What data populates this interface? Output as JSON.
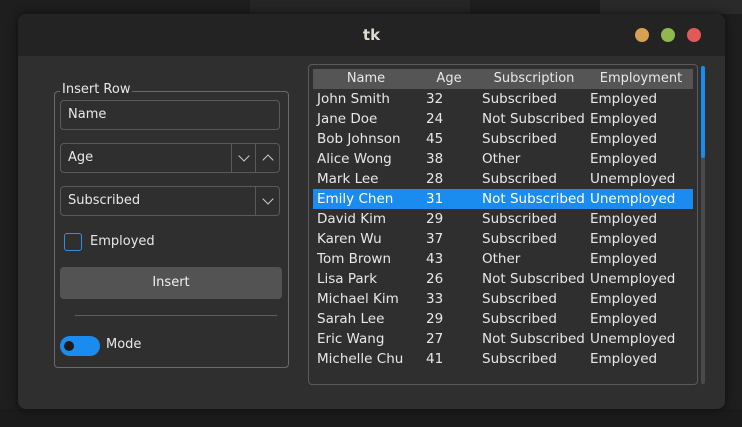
{
  "window": {
    "title": "tk"
  },
  "colors": {
    "accent": "#1a8cf0",
    "window_bg": "#2f2f2f",
    "titlebar_bg": "#232323",
    "minimize": "#d6a152",
    "maximize": "#90b84e",
    "close": "#e05a5a"
  },
  "form": {
    "legend": "Insert Row",
    "name_value": "Name",
    "age_value": "Age",
    "subscription_value": "Subscribed",
    "employed_label": "Employed",
    "employed_checked": false,
    "insert_label": "Insert",
    "mode_label": "Mode",
    "mode_on": true
  },
  "table": {
    "columns": [
      "Name",
      "Age",
      "Subscription",
      "Employment"
    ],
    "selected_index": 5,
    "rows": [
      [
        "John Smith",
        "32",
        "Subscribed",
        "Employed"
      ],
      [
        "Jane Doe",
        "24",
        "Not Subscribed",
        "Employed"
      ],
      [
        "Bob Johnson",
        "45",
        "Subscribed",
        "Employed"
      ],
      [
        "Alice Wong",
        "38",
        "Other",
        "Employed"
      ],
      [
        "Mark Lee",
        "28",
        "Subscribed",
        "Unemployed"
      ],
      [
        "Emily Chen",
        "31",
        "Not Subscribed",
        "Unemployed"
      ],
      [
        "David Kim",
        "29",
        "Subscribed",
        "Employed"
      ],
      [
        "Karen Wu",
        "37",
        "Subscribed",
        "Employed"
      ],
      [
        "Tom Brown",
        "43",
        "Other",
        "Employed"
      ],
      [
        "Lisa Park",
        "26",
        "Not Subscribed",
        "Unemployed"
      ],
      [
        "Michael Kim",
        "33",
        "Subscribed",
        "Employed"
      ],
      [
        "Sarah Lee",
        "29",
        "Subscribed",
        "Employed"
      ],
      [
        "Eric Wang",
        "27",
        "Not Subscribed",
        "Unemployed"
      ],
      [
        "Michelle Chu",
        "41",
        "Subscribed",
        "Employed"
      ]
    ]
  }
}
